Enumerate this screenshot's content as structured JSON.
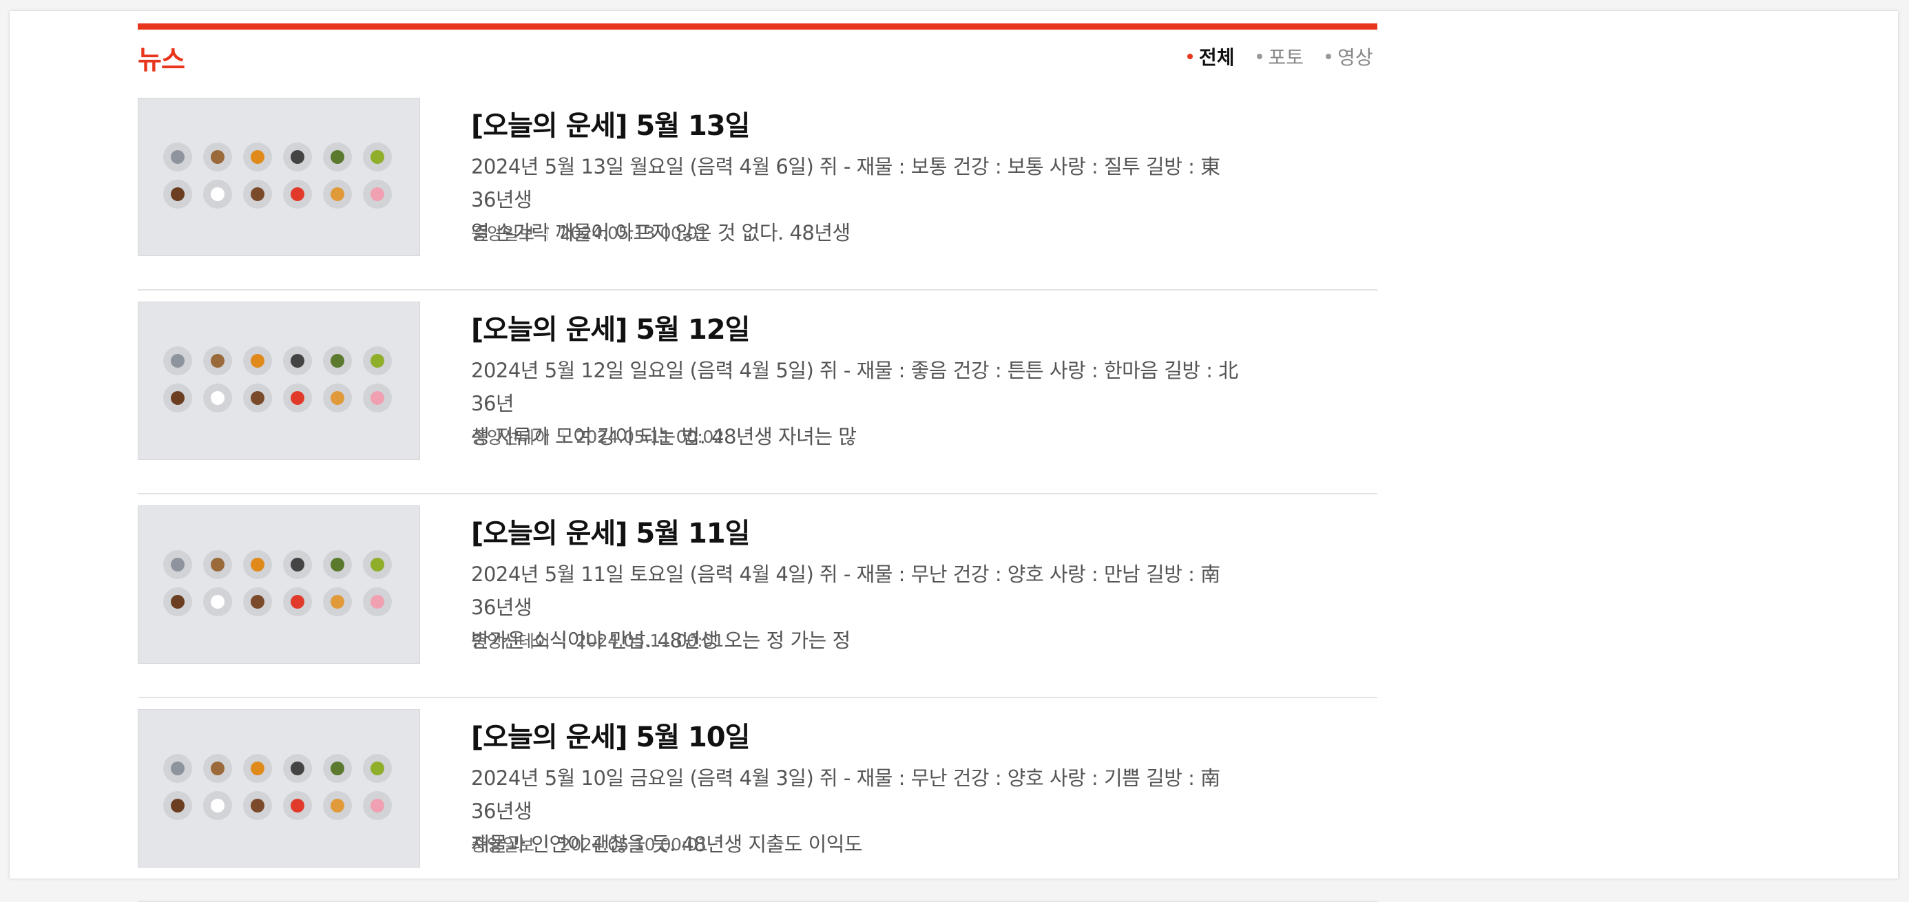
{
  "section": {
    "title": "뉴스"
  },
  "tabs": [
    {
      "label": "전체",
      "active": true
    },
    {
      "label": "포토",
      "active": false
    },
    {
      "label": "영상",
      "active": false
    }
  ],
  "colors": {
    "accent": "#e8361c",
    "thumb_bg": "#e4e5e9"
  },
  "zodiac_icons": [
    {
      "name": "rat-icon",
      "color": "#8e949e"
    },
    {
      "name": "ox-icon",
      "color": "#9a6a3a"
    },
    {
      "name": "tiger-icon",
      "color": "#e08a1c"
    },
    {
      "name": "rabbit-icon",
      "color": "#444444"
    },
    {
      "name": "dragon-icon",
      "color": "#5b7a2e"
    },
    {
      "name": "snake-icon",
      "color": "#8fae2a"
    },
    {
      "name": "horse-icon",
      "color": "#6b3e22"
    },
    {
      "name": "sheep-icon",
      "color": "#ffffff"
    },
    {
      "name": "monkey-icon",
      "color": "#7a4a2a"
    },
    {
      "name": "rooster-icon",
      "color": "#e23a2a"
    },
    {
      "name": "dog-icon",
      "color": "#e09a3a"
    },
    {
      "name": "pig-icon",
      "color": "#f0a0b0"
    }
  ],
  "articles": [
    {
      "title": "[오늘의 운세] 5월 13일",
      "desc_line1": "2024년 5월 13일 월요일 (음력 4월 6일)     쥐 - 재물 : 보통 건강 : 보통 사랑 : 질투 길방 : 東 36년생",
      "desc_line2": "열 손가락 깨물어 아프지 않은 것 없다. 48년생",
      "source": "중앙일보",
      "date": "2024.05.13 00:01"
    },
    {
      "title": "[오늘의 운세] 5월 12일",
      "desc_line1": "2024년 5월 12일 일요일 (음력 4월 5일)     쥐 - 재물 : 좋음 건강 : 튼튼 사랑 : 한마음 길방 : 北 36년",
      "desc_line2": "생 지류가 모여 강이 되는 법. 48년생 자녀는 많",
      "source": "중앙선데이",
      "date": "2024.05.11 00:02"
    },
    {
      "title": "[오늘의 운세] 5월 11일",
      "desc_line1": "2024년 5월 11일 토요일 (음력 4월 4일)     쥐 - 재물 : 무난 건강 : 양호 사랑 : 만남 길방 : 南 36년생",
      "desc_line2": "반가운 소식이나 만남. 48년생 오는 정 가는 정",
      "source": "중앙선데이",
      "date": "2024.05.11 00:01"
    },
    {
      "title": "[오늘의 운세] 5월 10일",
      "desc_line1": "2024년 5월 10일 금요일 (음력 4월 3일)     쥐 - 재물 : 무난 건강 : 양호 사랑 : 기쁨 길방 : 南 36년생",
      "desc_line2": "재물과 인연이 괜찮을 듯. 48년생 지출도 이익도",
      "source": "중앙일보",
      "date": "2024.05.10 00:01"
    }
  ]
}
